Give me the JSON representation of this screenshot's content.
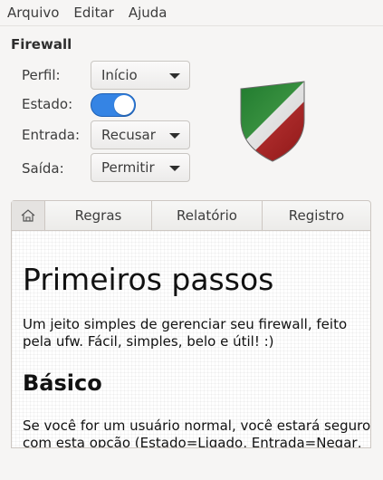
{
  "menubar": {
    "items": [
      "Arquivo",
      "Editar",
      "Ajuda"
    ]
  },
  "firewall": {
    "title": "Firewall",
    "profile_label": "Perfil:",
    "profile_value": "Início",
    "status_label": "Estado:",
    "status_on": true,
    "incoming_label": "Entrada:",
    "incoming_value": "Recusar",
    "outgoing_label": "Saída:",
    "outgoing_value": "Permitir"
  },
  "shield_icon": "shield-icon",
  "tabs": {
    "home_icon": "home-icon",
    "items": [
      "Regras",
      "Relatório",
      "Registro"
    ]
  },
  "content": {
    "heading": "Primeiros passos",
    "intro": "Um jeito simples de gerenciar seu firewall, feito pela ufw. Fácil, simples, belo e útil! :)",
    "subheading": "Básico",
    "paragraph": "Se você for um usuário normal, você estará seguro com esta opção (Estado=Ligado, Entrada=Negar, Saída=Permitir)."
  },
  "colors": {
    "switch_on": "#3584e4",
    "window_bg": "#f6f5f4"
  }
}
